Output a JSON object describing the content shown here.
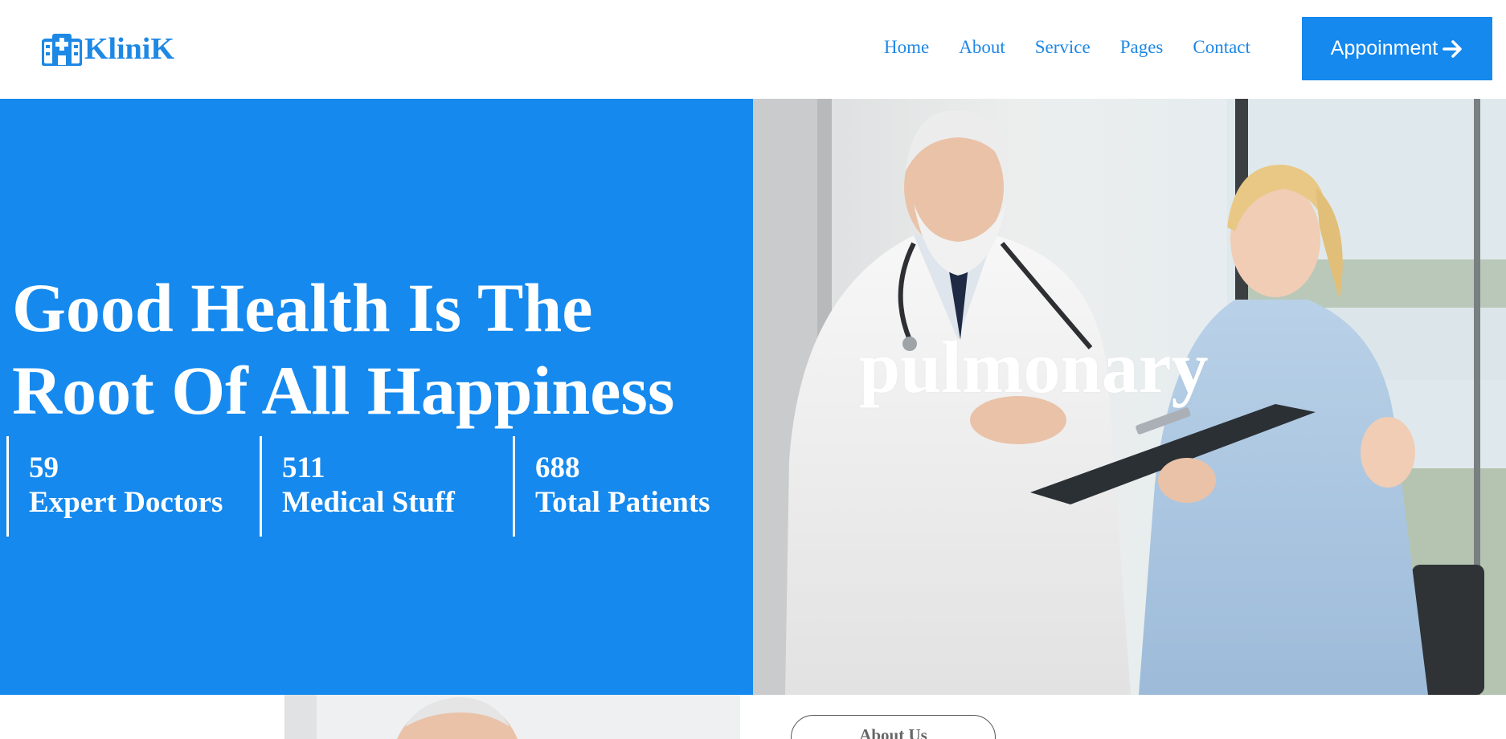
{
  "brand": {
    "name": "KliniK",
    "icon": "hospital-icon",
    "color": "#1e88e5"
  },
  "nav": {
    "links": [
      "Home",
      "About",
      "Service",
      "Pages",
      "Contact"
    ],
    "cta": "Appoinment",
    "cta_icon": "arrow-right-icon"
  },
  "hero": {
    "title_line1": "Good Health Is The",
    "title_line2": "Root Of All Happiness",
    "overlay_text": "pulmonary",
    "image_alt": "doctor-and-nurse-photo",
    "stats": [
      {
        "value": "59",
        "label": "Expert Doctors"
      },
      {
        "value": "511",
        "label": "Medical Stuff"
      },
      {
        "value": "688",
        "label": "Total Patients"
      }
    ]
  },
  "about": {
    "button_label": "About Us"
  },
  "colors": {
    "primary": "#1589ee",
    "white": "#ffffff"
  }
}
